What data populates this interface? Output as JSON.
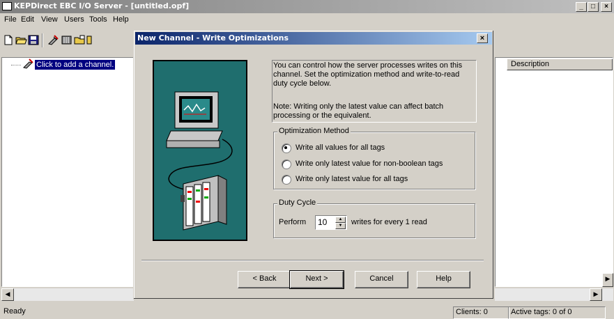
{
  "window": {
    "title": "KEPDirect EBC I/O Server - [untitled.opf]",
    "controls": [
      "_",
      "□",
      "×"
    ]
  },
  "menu": {
    "items": [
      "File",
      "Edit",
      "View",
      "Users",
      "Tools",
      "Help"
    ]
  },
  "tree": {
    "item": "Click to add a channel."
  },
  "list": {
    "column": "Description"
  },
  "dialog": {
    "title": "New Channel - Write Optimizations",
    "close": "×",
    "description": "You can control how the server processes writes on this channel.  Set the optimization method and write-to-read duty cycle below.",
    "note": "Note:  Writing only the latest value can affect batch processing or the equivalent.",
    "optimization": {
      "label": "Optimization Method",
      "options": [
        "Write all values for all tags",
        "Write only latest value for non-boolean tags",
        "Write only latest value for all tags"
      ],
      "selected_index": 0
    },
    "duty": {
      "label": "Duty Cycle",
      "prefix": "Perform",
      "value": "10",
      "suffix": "writes for every 1 read"
    },
    "buttons": {
      "back": "< Back",
      "next": "Next >",
      "cancel": "Cancel",
      "help": "Help"
    }
  },
  "status": {
    "text": "Ready",
    "clients": "Clients:  0",
    "active_tags": "Active tags:  0 of 0"
  },
  "colors": {
    "title_active": "#0a246a",
    "title_inactive": "#808080",
    "selection": "#000080",
    "illustration_bg": "#1f6e6e"
  }
}
